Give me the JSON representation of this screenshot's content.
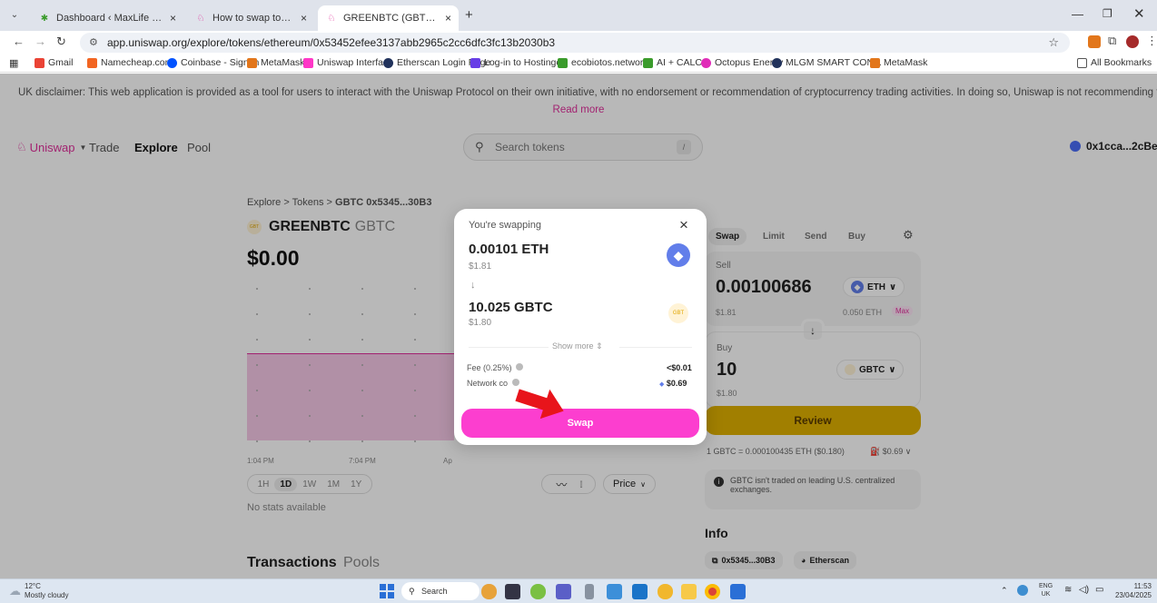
{
  "browser": {
    "tabs": [
      {
        "title": "Dashboard ‹ MaxLife Global Ma",
        "close": "×"
      },
      {
        "title": "How to swap tokens with the U",
        "close": "×"
      },
      {
        "title": "GREENBTC (GBTC): Buy and sell",
        "close": "×"
      }
    ],
    "new_tab": "+",
    "url": "app.uniswap.org/explore/tokens/ethereum/0x53452efee3137abb2965c2cc6dfc3fc13b2030b3",
    "bookmarks": [
      "Gmail",
      "Namecheap.com",
      "Coinbase - Sign In",
      "MetaMask",
      "Uniswap Interface",
      "Etherscan Login Page",
      "Log-in to Hostinger",
      "ecobiotos.network",
      "AI + CALCS",
      "Octopus Energy",
      "MLGM SMART CON...",
      "MetaMask"
    ],
    "all_bookmarks": "All Bookmarks"
  },
  "disclaimer": {
    "text": "UK disclaimer: This web application is provided as a tool for users to interact with the Uniswap Protocol on their own initiative, with no endorsement or recommendation of cryptocurrency trading activities. In doing so, Uniswap is not recommending that users or pot...",
    "read_more": "Read more"
  },
  "nav": {
    "brand": "Uniswap",
    "items": [
      "Trade",
      "Explore",
      "Pool"
    ],
    "search_placeholder": "Search tokens",
    "search_shortcut": "/",
    "wallet": "0x1cca...2cBe"
  },
  "token": {
    "breadcrumb_explore": "Explore",
    "breadcrumb_tokens": "Tokens",
    "breadcrumb_current": "GBTC 0x5345...30B3",
    "name": "GREENBTC",
    "symbol": "GBTC",
    "logo_text": "GBT",
    "price": "$0.00",
    "time_labels": [
      "1:04 PM",
      "7:04 PM",
      "Ap"
    ],
    "ranges": [
      "1H",
      "1D",
      "1W",
      "1M",
      "1Y"
    ],
    "chart_type_label": "Price",
    "no_stats": "No stats available",
    "tab_transactions": "Transactions",
    "tab_pools": "Pools"
  },
  "swap_panel": {
    "tabs": [
      "Swap",
      "Limit",
      "Send",
      "Buy"
    ],
    "sell_label": "Sell",
    "sell_amount": "0.00100686",
    "sell_token": "ETH",
    "sell_usd": "$1.81",
    "sell_balance": "0.050 ETH",
    "max": "Max",
    "buy_label": "Buy",
    "buy_amount": "10",
    "buy_token": "GBTC",
    "buy_usd": "$1.80",
    "review": "Review",
    "rate": "1 GBTC = 0.000100435 ETH ($0.180)",
    "gas": "$0.69",
    "warning": "GBTC isn't traded on leading U.S. centralized exchanges.",
    "info_title": "Info",
    "address_chip": "0x5345...30B3",
    "etherscan_chip": "Etherscan"
  },
  "modal": {
    "title": "You're swapping",
    "close": "×",
    "from_amount": "0.00101 ETH",
    "from_usd": "$1.81",
    "to_amount": "10.025 GBTC",
    "to_usd": "$1.80",
    "to_logo": "GBT",
    "show_more": "Show more",
    "fee_label": "Fee (0.25%)",
    "fee_value": "<$0.01",
    "network_label": "Network co",
    "network_value": "$0.69",
    "swap_button": "Swap"
  },
  "taskbar": {
    "weather_temp": "12°C",
    "weather_desc": "Mostly cloudy",
    "search": "Search",
    "lang_top": "ENG",
    "lang_bottom": "UK",
    "time": "11:53",
    "date": "23/04/2025"
  },
  "colors": {
    "pink": "#fc3ecf",
    "uniswap_pink": "#e12f9b",
    "review_yellow": "#e0b000",
    "eth_blue": "#627eea",
    "arrow_red": "#e8141b"
  }
}
